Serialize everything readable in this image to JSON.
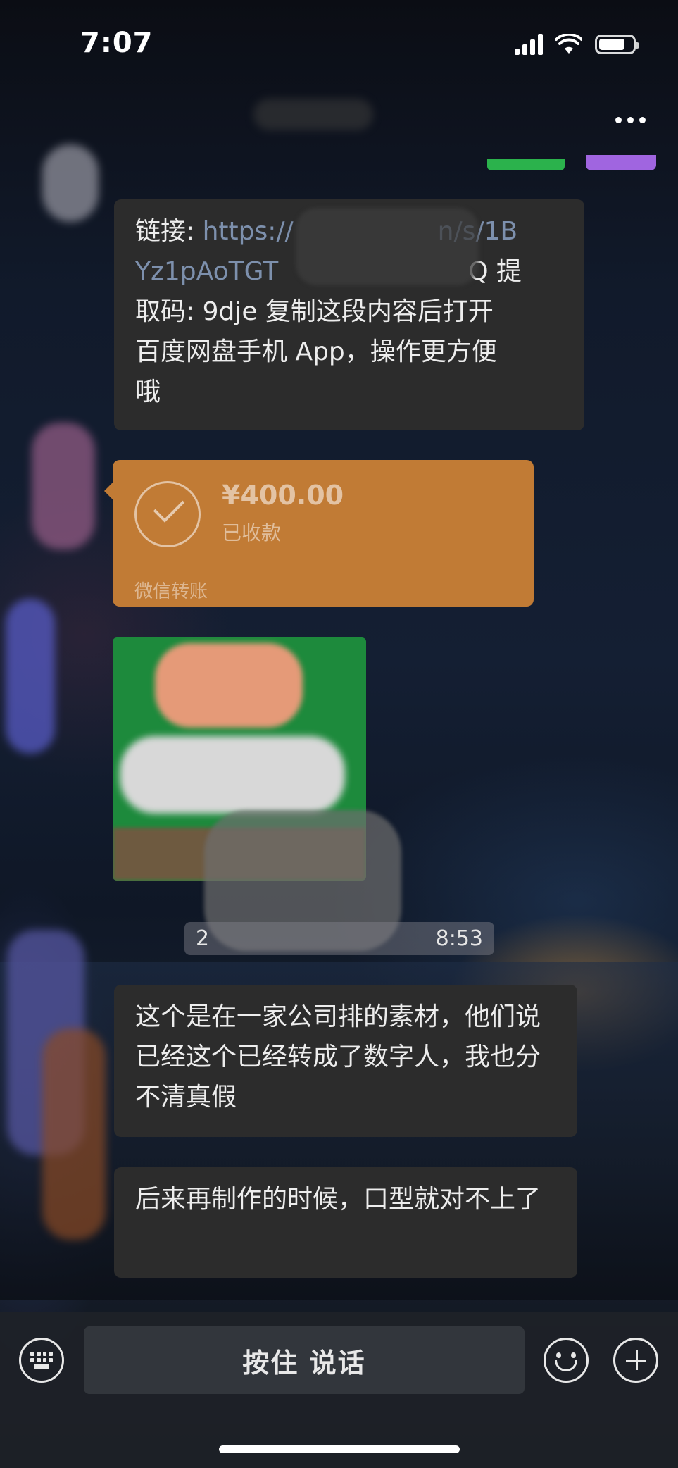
{
  "status_bar": {
    "time": "7:07"
  },
  "top_bar": {
    "more_label": "..."
  },
  "messages": {
    "link_message": {
      "lines": [
        {
          "prefix": "链接: ",
          "link": "https://",
          "suffix": "n/s/1B"
        },
        {
          "prefix": "",
          "link": "Yz1pAoTGT",
          "suffix": "Q 提"
        },
        {
          "prefix": "取码: 9dje 复制这段内容后打开",
          "link": "",
          "suffix": ""
        },
        {
          "prefix": "百度网盘手机 App，操作更方便",
          "link": "",
          "suffix": ""
        },
        {
          "prefix": "哦",
          "link": "",
          "suffix": ""
        }
      ]
    },
    "transfer": {
      "amount": "¥400.00",
      "status": "已收款",
      "label": "微信转账"
    },
    "timestamp": {
      "left": "2",
      "right": "8:53"
    },
    "text_message_1": "这个是在一家公司排的素材，他们说已经这个已经转成了数字人，我也分不清真假",
    "text_message_2": "后来再制作的时候，口型就对不上了"
  },
  "input_bar": {
    "hold_to_talk_label": "按住 说话",
    "keyboard_icon": "keyboard-icon",
    "emoji_icon": "smile-icon",
    "plus_icon": "plus-icon"
  }
}
